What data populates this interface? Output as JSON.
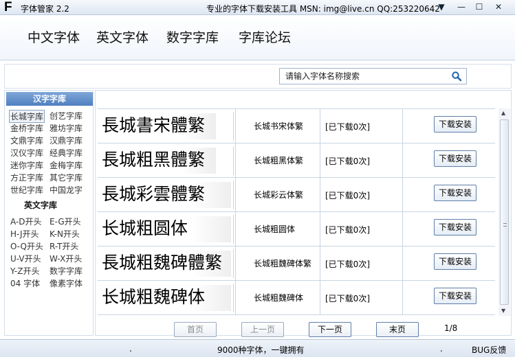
{
  "titlebar": {
    "logo": "F",
    "title": "字体管家 2.2",
    "info": "专业的字体下载安装工具 MSN: img@live.cn  QQ:253220642",
    "buttons": {
      "menu": "▼",
      "minimize": "—",
      "maximize": "☐",
      "close": "✕"
    }
  },
  "nav": {
    "items": [
      "中文字体",
      "英文字体",
      "数字字库",
      "字库论坛"
    ]
  },
  "search": {
    "placeholder": "请输入字体名称搜索",
    "icon": "search-icon"
  },
  "sidebar": {
    "heading": "汉字字库",
    "chinese_links": [
      "长城字库",
      "创艺字库",
      "金桥字库",
      "雅坊字库",
      "文鼎字库",
      "汉鼎字库",
      "汉仪字库",
      "经典字库",
      "迷你字库",
      "金梅字库",
      "方正字库",
      "其它字库",
      "世纪字库",
      "中国龙字"
    ],
    "heading2": "英文字库",
    "english_links": [
      "A-D开头",
      "E-G开头",
      "H-J开头",
      "K-N开头",
      "O-Q开头",
      "R-T开头",
      "U-V开头",
      "W-X开头",
      "Y-Z开头",
      "数字字库",
      "04 字体",
      "像素字体"
    ]
  },
  "fonts": [
    {
      "preview": "長城書宋體繁",
      "name": "长城书宋体繁",
      "count": "[已下载0次]",
      "button": "下载安装"
    },
    {
      "preview": "長城粗黑體繁",
      "name": "长城粗黑体繁",
      "count": "[已下载0次]",
      "button": "下载安装"
    },
    {
      "preview": "長城彩雲體繁",
      "name": "长城彩云体繁",
      "count": "[已下载0次]",
      "button": "下载安装"
    },
    {
      "preview": "长城粗圆体",
      "name": "长城粗圆体",
      "count": "[已下载0次]",
      "button": "下载安装"
    },
    {
      "preview": "長城粗魏碑體繁",
      "name": "长城粗魏碑体繁",
      "count": "[已下载0次]",
      "button": "下载安装"
    },
    {
      "preview": "长城粗魏碑体",
      "name": "长城粗魏碑体",
      "count": "[已下载0次]",
      "button": "下载安装"
    }
  ],
  "pager": {
    "first": "首页",
    "prev": "上一页",
    "next": "下一页",
    "last": "末页",
    "info": "1/8"
  },
  "status": {
    "dot1": ".",
    "center": "9000种字体，一键拥有",
    "dot2": ".",
    "bug": "BUG反馈"
  },
  "colors": {
    "sidebar_header": "#5b86c6",
    "border": "#c9d4e2",
    "statusbar": "#dce5f1"
  }
}
